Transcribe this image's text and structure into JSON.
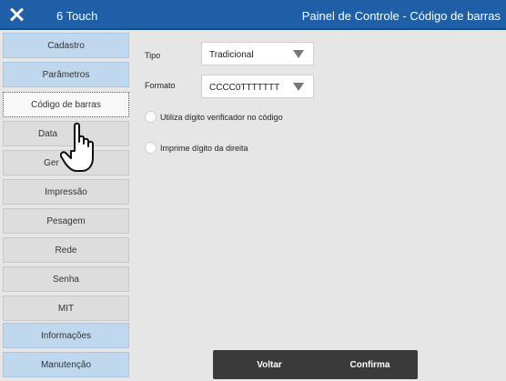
{
  "header": {
    "app_name": "6 Touch",
    "title": "Painel de Controle - Código de barras",
    "close_icon": "close-icon"
  },
  "sidebar": {
    "items": [
      {
        "label": "Cadastro"
      },
      {
        "label": "Parâmetros"
      },
      {
        "label": "Código de barras"
      },
      {
        "label": "Data"
      },
      {
        "label": "Ger"
      },
      {
        "label": "Impressão"
      },
      {
        "label": "Pesagem"
      },
      {
        "label": "Rede"
      },
      {
        "label": "Senha"
      },
      {
        "label": "MIT"
      },
      {
        "label": "Informações"
      },
      {
        "label": "Manutenção"
      }
    ]
  },
  "form": {
    "tipo_label": "Tipo",
    "tipo_value": "Tradicional",
    "formato_label": "Formato",
    "formato_value": "CCCC0TTTTTTT",
    "option1_label": "Utiliza dígito verificador no código",
    "option2_label": "Imprime dígito da direita"
  },
  "footer": {
    "back_label": "Voltar",
    "confirm_label": "Confirma"
  },
  "colors": {
    "titlebar": "#1f5fa8",
    "sidebar_blue": "#bfd8ee",
    "sidebar_gray": "#dddddd",
    "button": "#3a3a3a"
  }
}
